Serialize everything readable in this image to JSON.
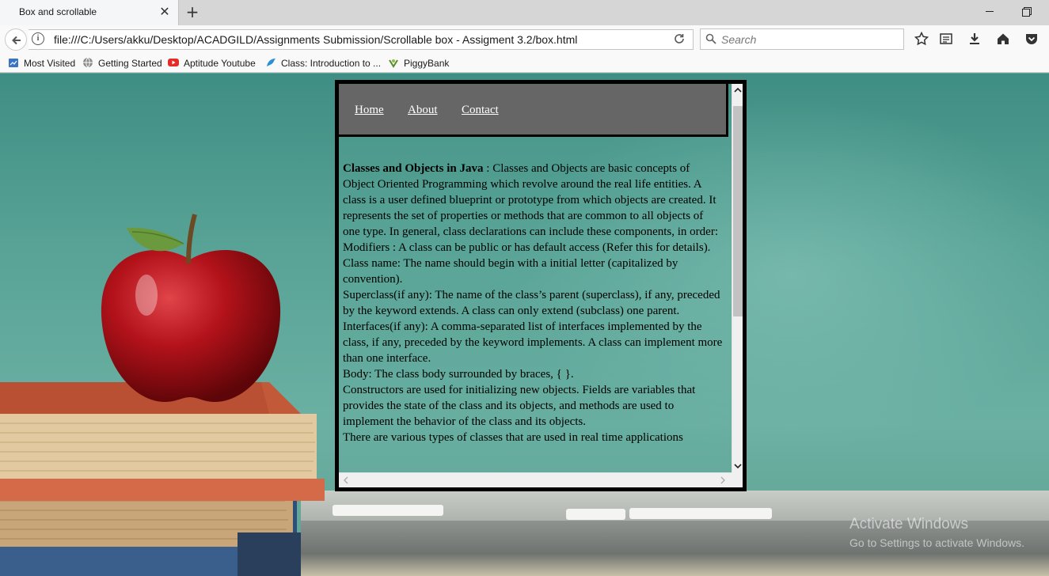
{
  "browser": {
    "tab_title": "Box and scrollable",
    "url": "file:///C:/Users/akku/Desktop/ACADGILD/Assignments Submission/Scrollable box - Assigment 3.2/box.html",
    "search_placeholder": "Search",
    "bookmarks": [
      {
        "label": "Most Visited",
        "icon": "bookmarks-folder-icon"
      },
      {
        "label": "Getting Started",
        "icon": "globe-icon"
      },
      {
        "label": "Aptitude Youtube",
        "icon": "youtube-icon"
      },
      {
        "label": "Class: Introduction to ...",
        "icon": "bird-icon"
      },
      {
        "label": "PiggyBank",
        "icon": "piggybank-icon"
      }
    ]
  },
  "box": {
    "nav": [
      "Home",
      "About",
      "Contact"
    ],
    "heading": "Classes and Objects in Java",
    "paragraphs": [
      " : Classes and Objects are basic concepts of Object Oriented Programming which revolve around the real life entities. A class is a user defined blueprint or prototype from which objects are created. It represents the set of properties or methods that are common to all objects of one type. In general, class declarations can include these components, in order: Modifiers : A class can be public or has default access (Refer this for details).",
      "Class name: The name should begin with a initial letter (capitalized by convention).",
      "Superclass(if any): The name of the class’s parent (superclass), if any, preceded by the keyword extends. A class can only extend (subclass) one parent.",
      "Interfaces(if any): A comma-separated list of interfaces implemented by the class, if any, preceded by the keyword implements. A class can implement more than one interface.",
      "Body: The class body surrounded by braces, { }.",
      "Constructors are used for initializing new objects. Fields are variables that provides the state of the class and its objects, and methods are used to implement the behavior of the class and its objects.",
      "There are various types of classes that are used in real time applications"
    ]
  },
  "watermark": {
    "line1": "Activate Windows",
    "line2": "Go to Settings to activate Windows."
  },
  "colors": {
    "chalkboard": "#5fa89c",
    "nav_bg": "#666666",
    "apple_red": "#b3121a"
  }
}
